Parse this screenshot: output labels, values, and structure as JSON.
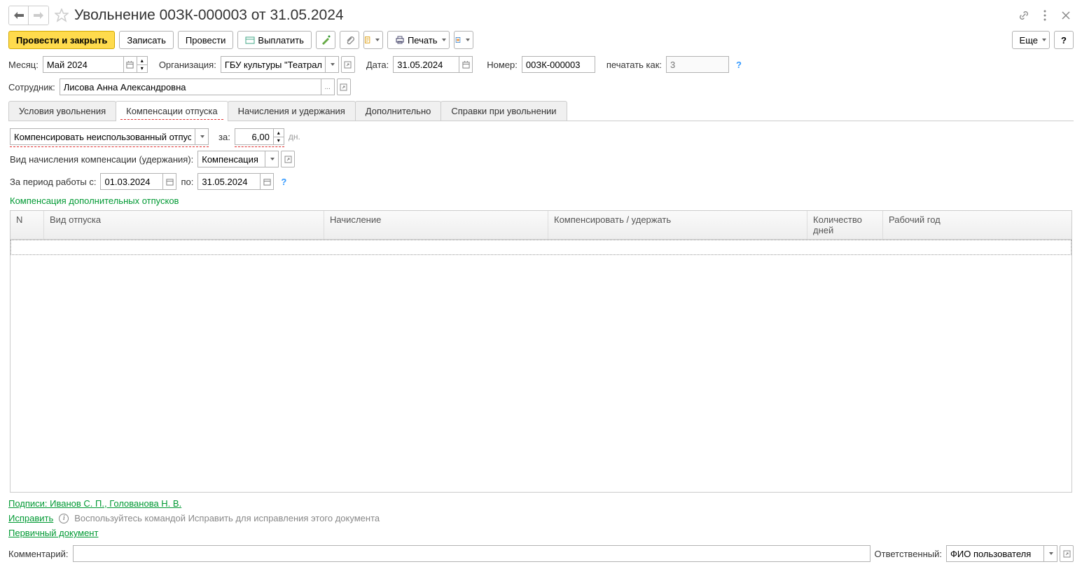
{
  "header": {
    "title": "Увольнение 00ЗК-000003 от 31.05.2024"
  },
  "toolbar": {
    "post_and_close": "Провести и закрыть",
    "save": "Записать",
    "post": "Провести",
    "pay": "Выплатить",
    "print": "Печать",
    "more": "Еще"
  },
  "fields": {
    "month_label": "Месяц:",
    "month_value": "Май 2024",
    "org_label": "Организация:",
    "org_value": "ГБУ культуры \"Театральны",
    "date_label": "Дата:",
    "date_value": "31.05.2024",
    "number_label": "Номер:",
    "number_value": "00ЗК-000003",
    "print_as_label": "печатать как:",
    "print_as_value": "3",
    "employee_label": "Сотрудник:",
    "employee_value": "Лисова Анна Александровна"
  },
  "tabs": {
    "t1": "Условия увольнения",
    "t2": "Компенсации отпуска",
    "t3": "Начисления и удержания",
    "t4": "Дополнительно",
    "t5": "Справки при увольнении"
  },
  "comp": {
    "mode": "Компенсировать неиспользованный отпуск",
    "for_label": "за:",
    "days_value": "6,00",
    "days_unit": "дн.",
    "type_label": "Вид начисления компенсации (удержания):",
    "type_value": "Компенсация отп",
    "period_from_label": "За период работы с:",
    "period_from": "01.03.2024",
    "period_to_label": "по:",
    "period_to": "31.05.2024",
    "section_title": "Компенсация дополнительных отпусков"
  },
  "grid": {
    "col_n": "N",
    "col_type": "Вид отпуска",
    "col_accrual": "Начисление",
    "col_comp": "Компенсировать / удержать",
    "col_days": "Количество дней",
    "col_year": "Рабочий год"
  },
  "footer": {
    "signatures": "Подписи: Иванов С. П., Голованова Н. В.",
    "fix": "Исправить",
    "fix_hint": "Воспользуйтесь командой Исправить для исправления этого документа",
    "primary_doc": "Первичный документ",
    "comment_label": "Комментарий:",
    "responsible_label": "Ответственный:",
    "responsible_value": "ФИО пользователя"
  }
}
